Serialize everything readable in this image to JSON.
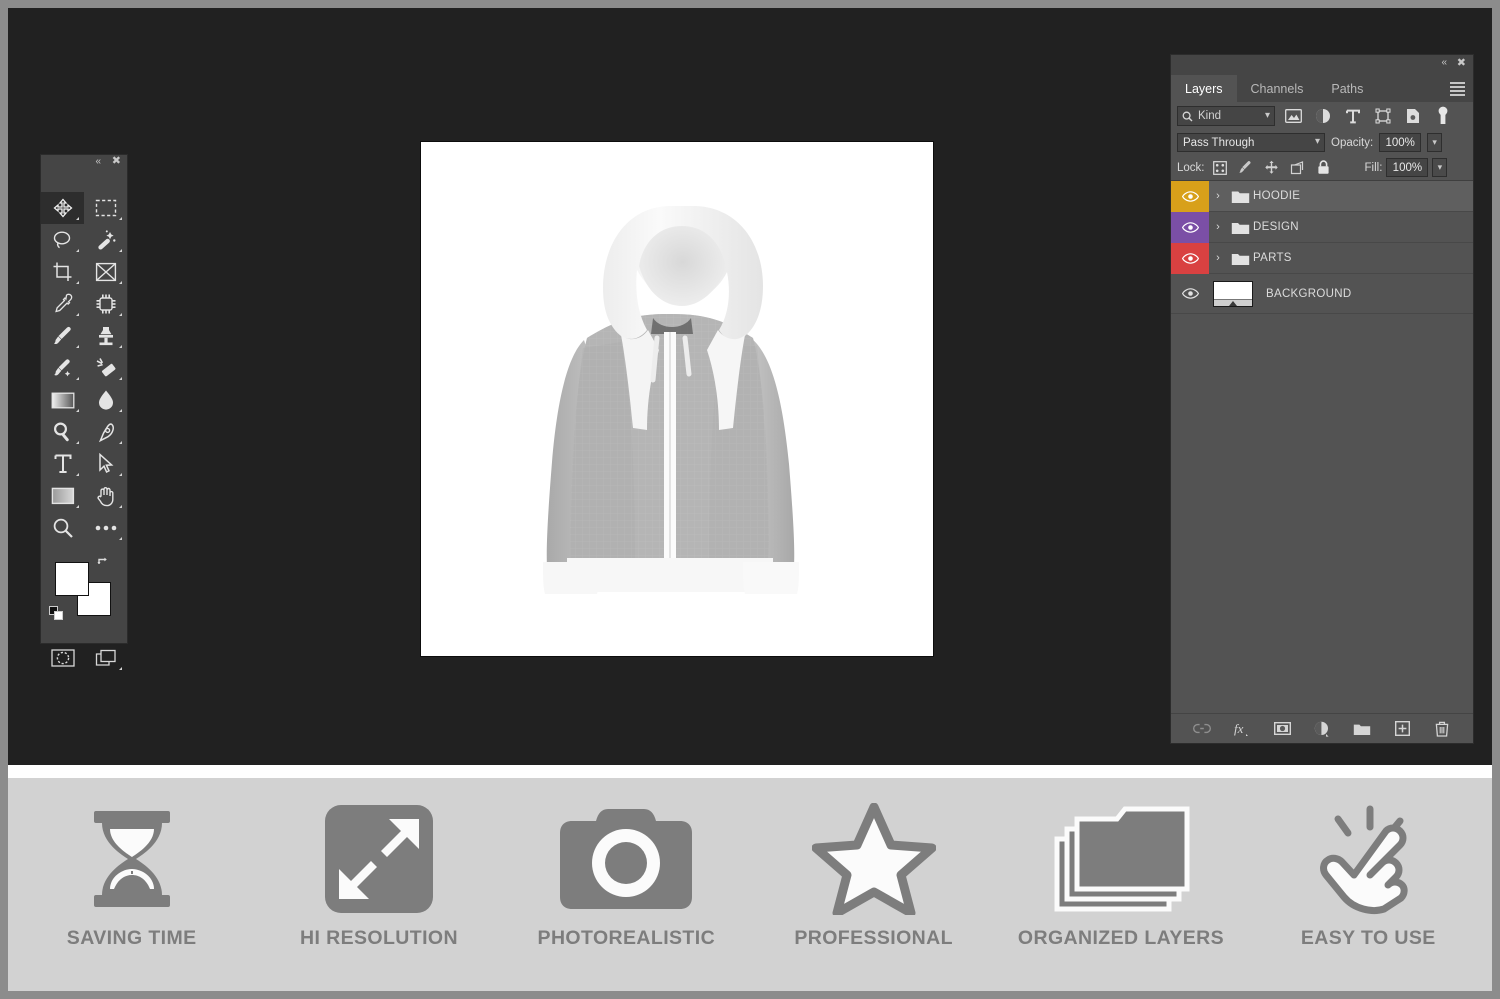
{
  "app": {
    "name": "Adobe Photoshop Mockup Workspace",
    "workspace_bg": "#212121",
    "outer_border_color": "#8c8c8c"
  },
  "toolbar": {
    "collapse_label": "«",
    "close_label": "✖",
    "tools": [
      {
        "name": "move-tool",
        "row": 0,
        "col": 0,
        "active": true
      },
      {
        "name": "rectangular-marquee-tool",
        "row": 0,
        "col": 1,
        "active": false
      },
      {
        "name": "lasso-tool",
        "row": 1,
        "col": 0,
        "active": false
      },
      {
        "name": "magic-wand-tool",
        "row": 1,
        "col": 1,
        "active": false
      },
      {
        "name": "crop-tool",
        "row": 2,
        "col": 0,
        "active": false
      },
      {
        "name": "frame-tool",
        "row": 2,
        "col": 1,
        "active": false
      },
      {
        "name": "eyedropper-tool",
        "row": 3,
        "col": 0,
        "active": false
      },
      {
        "name": "spot-healing-brush-tool",
        "row": 3,
        "col": 1,
        "active": false
      },
      {
        "name": "brush-tool",
        "row": 4,
        "col": 0,
        "active": false
      },
      {
        "name": "clone-stamp-tool",
        "row": 4,
        "col": 1,
        "active": false
      },
      {
        "name": "history-brush-tool",
        "row": 5,
        "col": 0,
        "active": false
      },
      {
        "name": "eraser-tool",
        "row": 5,
        "col": 1,
        "active": false
      },
      {
        "name": "gradient-tool",
        "row": 6,
        "col": 0,
        "active": false
      },
      {
        "name": "blur-tool",
        "row": 6,
        "col": 1,
        "active": false
      },
      {
        "name": "dodge-tool",
        "row": 7,
        "col": 0,
        "active": false
      },
      {
        "name": "pen-tool",
        "row": 7,
        "col": 1,
        "active": false
      },
      {
        "name": "horizontal-type-tool",
        "row": 8,
        "col": 0,
        "active": false
      },
      {
        "name": "path-selection-tool",
        "row": 8,
        "col": 1,
        "active": false
      },
      {
        "name": "rectangle-tool",
        "row": 9,
        "col": 0,
        "active": false
      },
      {
        "name": "hand-tool",
        "row": 9,
        "col": 1,
        "active": false
      },
      {
        "name": "zoom-tool",
        "row": 10,
        "col": 0,
        "active": false
      },
      {
        "name": "edit-toolbar-tool",
        "row": 10,
        "col": 1,
        "active": false
      }
    ],
    "foreground_color": "#ffffff",
    "background_color": "#ffffff",
    "bottom_tools": [
      "quick-mask-mode",
      "screen-mode"
    ]
  },
  "canvas": {
    "document_background": "#ffffff",
    "artwork_name": "hoodie-mockup",
    "artwork_description": "Front view zip-up hoodie mockup, light gray body with white hood, cuffs and hem"
  },
  "layers_panel": {
    "collapse_label": "«",
    "close_label": "✖",
    "tabs": [
      {
        "label": "Layers",
        "active": true
      },
      {
        "label": "Channels",
        "active": false
      },
      {
        "label": "Paths",
        "active": false
      }
    ],
    "filter": {
      "kind_label": "Kind",
      "icons": [
        "pixel-layer-filter-icon",
        "adjustment-layer-filter-icon",
        "type-layer-filter-icon",
        "shape-layer-filter-icon",
        "smart-object-filter-icon",
        "filter-toggle-icon"
      ]
    },
    "blend": {
      "mode": "Pass Through",
      "opacity_label": "Opacity:",
      "opacity_value": "100%"
    },
    "lock": {
      "label": "Lock:",
      "icons": [
        "lock-transparent-pixels-icon",
        "lock-image-pixels-icon",
        "lock-position-icon",
        "lock-artboard-nesting-icon",
        "lock-all-icon"
      ],
      "fill_label": "Fill:",
      "fill_value": "100%"
    },
    "layers": [
      {
        "name": "HOODIE",
        "type": "group",
        "color": "#d8a01a",
        "visible": true,
        "selected": true
      },
      {
        "name": "DESIGN",
        "type": "group",
        "color": "#7b4fa6",
        "visible": true,
        "selected": false
      },
      {
        "name": "PARTS",
        "type": "group",
        "color": "#d94141",
        "visible": true,
        "selected": false
      },
      {
        "name": "BACKGROUND",
        "type": "image",
        "color": "",
        "visible": true,
        "selected": false
      }
    ],
    "footer_buttons": [
      "link-layers-icon",
      "add-layer-style-icon",
      "add-layer-mask-icon",
      "new-adjustment-layer-icon",
      "new-group-icon",
      "new-layer-icon",
      "delete-layer-icon"
    ]
  },
  "features": {
    "text_color": "#7d7d7d",
    "background": "#d2d2d2",
    "items": [
      {
        "label": "SAVING TIME",
        "icon": "hourglass-icon"
      },
      {
        "label": "HI RESOLUTION",
        "icon": "resize-arrows-icon"
      },
      {
        "label": "PHOTOREALISTIC",
        "icon": "camera-icon"
      },
      {
        "label": "PROFESSIONAL",
        "icon": "star-icon"
      },
      {
        "label": "ORGANIZED LAYERS",
        "icon": "stacked-folders-icon"
      },
      {
        "label": "EASY TO USE",
        "icon": "click-hand-icon"
      }
    ]
  }
}
